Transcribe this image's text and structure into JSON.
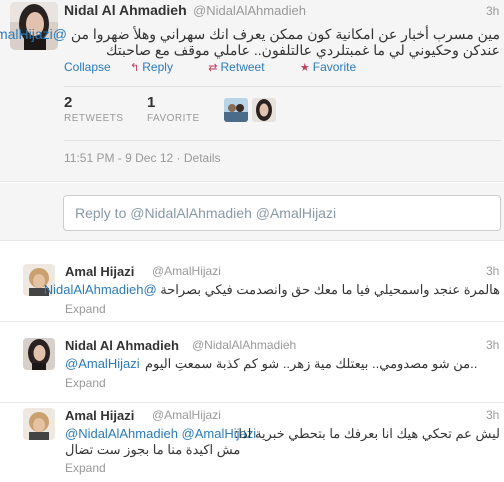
{
  "main_tweet": {
    "name": "Nidal Al Ahmadieh",
    "handle": "@NidalAlAhmadieh",
    "time": "3h",
    "mention": "@AmalHijazi",
    "text_line1": "مين مسرب أخبار عن امكانية كون ممكن يعرف انك سهراني وهلأ ضهروا من",
    "text_line2": "عندكن وحكيوني لي ما غمبتلردي عالتلفون.. عاملي موقف مع صاحبتك",
    "actions": {
      "collapse": "Collapse",
      "reply": "Reply",
      "retweet": "Retweet",
      "favorite": "Favorite"
    },
    "stats": {
      "retweets_count": "2",
      "retweets_label": "RETWEETS",
      "favorites_count": "1",
      "favorites_label": "FAVORITE"
    },
    "timestamp": "11:51 PM - 9 Dec 12",
    "details": "Details"
  },
  "reply_box": {
    "placeholder": "Reply to @NidalAlAhmadieh @AmalHijazi"
  },
  "replies": [
    {
      "name": "Amal Hijazi",
      "handle": "@AmalHijazi",
      "time": "3h",
      "mention": "@NidalAlAhmadieh",
      "text_line1": "هالمرة عنجد واسمحيلي فيا ما معك حق وانصدمت فيكي بصراحة",
      "text_line2": "",
      "expand": "Expand"
    },
    {
      "name": "Nidal Al Ahmadieh",
      "handle": "@NidalAlAhmadieh",
      "time": "3h",
      "mention": "@AmalHijazi",
      "text_line1": "..من شو مصدومي.. بيعتلك مية زهر.. شو كم كذبة سمعتِ اليوم",
      "text_line2": "",
      "expand": "Expand"
    },
    {
      "name": "Amal Hijazi",
      "handle": "@AmalHijazi",
      "time": "3h",
      "mention": "@NidalAlAhmadieh @AmalHijazi",
      "text_line1": "ليش عم تحكي هيك انا بعرفك ما بتحطي خبرية اذا:",
      "text_line2": "مش اكيدة منا ما بجوز ست تضال",
      "expand": "Expand"
    }
  ],
  "colors": {
    "link_blue": "#2b7bb9",
    "muted_gray": "#999999",
    "background_gray": "#f5f5f5",
    "action_icon": "#c04060"
  },
  "icons": {
    "reply": "reply-arrow-icon",
    "retweet": "retweet-icon",
    "favorite": "star-icon"
  }
}
